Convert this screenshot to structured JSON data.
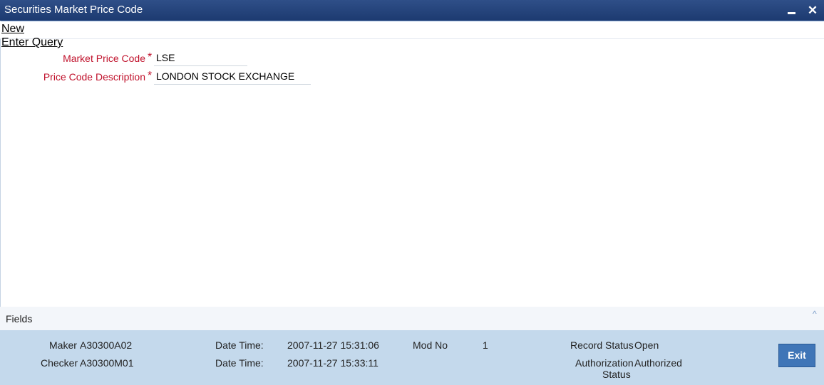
{
  "window": {
    "title": "Securities Market Price Code",
    "minimize_icon": "minimize-icon",
    "close_icon": "close-icon",
    "close_glyph": "✕"
  },
  "toolbar": {
    "new_label": "New",
    "enter_query_label": "Enter Query"
  },
  "form": {
    "market_price_code_label": "Market Price Code",
    "market_price_code_value": "LSE",
    "price_code_description_label": "Price Code Description",
    "price_code_description_value": "LONDON STOCK EXCHANGE",
    "required_marker": "*"
  },
  "fields_section": {
    "label": "Fields",
    "expand_icon": "chevron-up-icon",
    "expand_glyph": "^"
  },
  "audit": {
    "maker_label": "Maker",
    "maker_value": "A30300A02",
    "maker_datetime_label": "Date Time:",
    "maker_datetime_value": "2007-11-27 15:31:06",
    "checker_label": "Checker",
    "checker_value": "A30300M01",
    "checker_datetime_label": "Date Time:",
    "checker_datetime_value": "2007-11-27 15:33:11",
    "mod_no_label": "Mod No",
    "mod_no_value": "1",
    "record_status_label": "Record Status",
    "record_status_value": "Open",
    "authorization_status_label_line1": "Authorization",
    "authorization_status_label_line2": "Status",
    "authorization_status_value": "Authorized"
  },
  "buttons": {
    "exit_label": "Exit"
  }
}
